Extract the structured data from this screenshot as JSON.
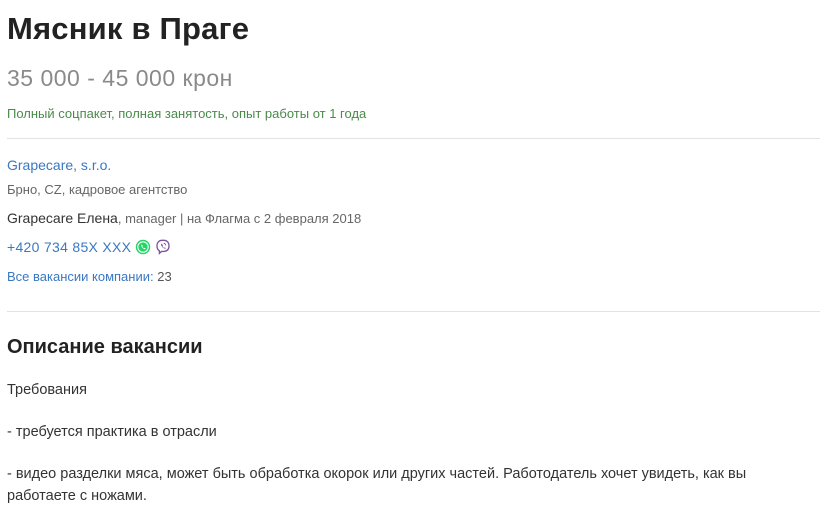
{
  "vacancy": {
    "title": "Мясник в Праге",
    "salary": "35 000 - 45 000 крон",
    "conditions": "Полный соцпакет, полная занятость, опыт работы от 1 года"
  },
  "company": {
    "name": "Grapecare, s.r.o.",
    "meta": "Брно, CZ, кадровое агентство"
  },
  "contact": {
    "name": "Grapecare Елена",
    "details": ", manager | на Флагма с 2 февраля 2018",
    "phone": "+420 734 85X XXX",
    "whatsapp_icon": "whatsapp-icon",
    "viber_icon": "viber-icon"
  },
  "vacancies": {
    "label": "Все вакансии компании:",
    "count": "23"
  },
  "description": {
    "heading": "Описание вакансии",
    "paragraphs": [
      "Требования",
      "- требуется практика в отрасли",
      "- видео разделки мяса, может быть обработка окорок или других частей. Работодатель хочет увидеть, как вы работаете с ножами."
    ]
  },
  "colors": {
    "link": "#3a78c2",
    "conditions": "#4a8a4a",
    "whatsapp": "#25d366",
    "viber": "#7b519d"
  }
}
